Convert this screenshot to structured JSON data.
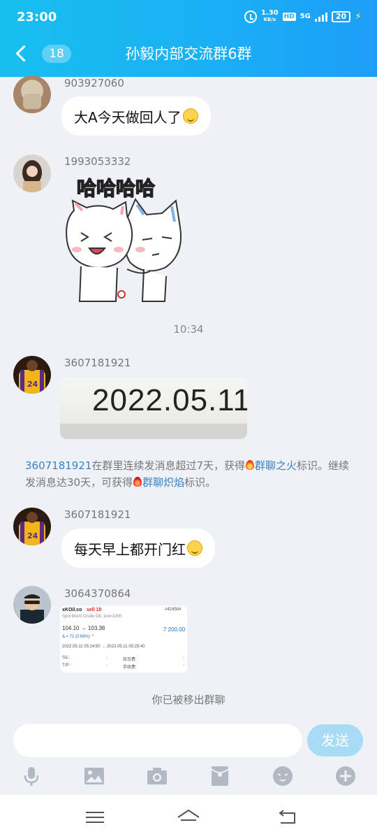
{
  "status_bar": {
    "time": "23:00",
    "speed_value": "1.30",
    "speed_unit": "KB/s",
    "hd_label": "HD",
    "network": "5G",
    "battery": "20"
  },
  "header": {
    "back_count": "18",
    "title": "孙毅内部交流群6群"
  },
  "messages": [
    {
      "sender": "903927060",
      "text": "大A今天做回人了"
    },
    {
      "sender": "1993053332",
      "sticker_text": "哈哈哈哈"
    },
    {
      "timestamp": "10:34"
    },
    {
      "sender": "3607181921",
      "image_text": "2022.05.11"
    },
    {
      "sender": "3607181921",
      "text": "每天早上都开门红"
    },
    {
      "sender": "3064370864"
    }
  ],
  "system_note": {
    "user": "3607181921",
    "part1": "在群里连续发消息超过7天，获得",
    "badge1": "群聊之火",
    "part2": "标识。继续发消息达30天，可获得",
    "badge2": "群聊炽焰",
    "part3": "标识。"
  },
  "trade_shot": {
    "brand": "xKOil.co",
    "action": "sell 10",
    "order_id": "#424584",
    "subtitle": "Spot Brent Crude Oil, 1lot=1000",
    "price_change": "104.10 → 103.38",
    "profit": "7 200.00",
    "delta": "Δ = 72 (0.69%) ⌃",
    "time_range": "2022.05.11 05:24:50 → 2022.05.11 05:29:40",
    "sl_label": "S/L:",
    "sl_value": "-",
    "tp_label": "T/P:",
    "tp_value": "-",
    "storage_label": "库存费:",
    "storage_value": "-",
    "fee_label": "手续费:",
    "fee_value": "-"
  },
  "kicked_notice": "你已被移出群聊",
  "composer": {
    "send_label": "发送"
  },
  "toolbar_icons": [
    "microphone-icon",
    "image-icon",
    "camera-icon",
    "red-packet-icon",
    "emoji-icon",
    "plus-icon"
  ],
  "colors": {
    "header_start": "#17bfee",
    "header_end": "#1d9df8",
    "send_button": "#a8dcf6",
    "link_blue": "#3b82c4",
    "background": "#eef1f6"
  }
}
